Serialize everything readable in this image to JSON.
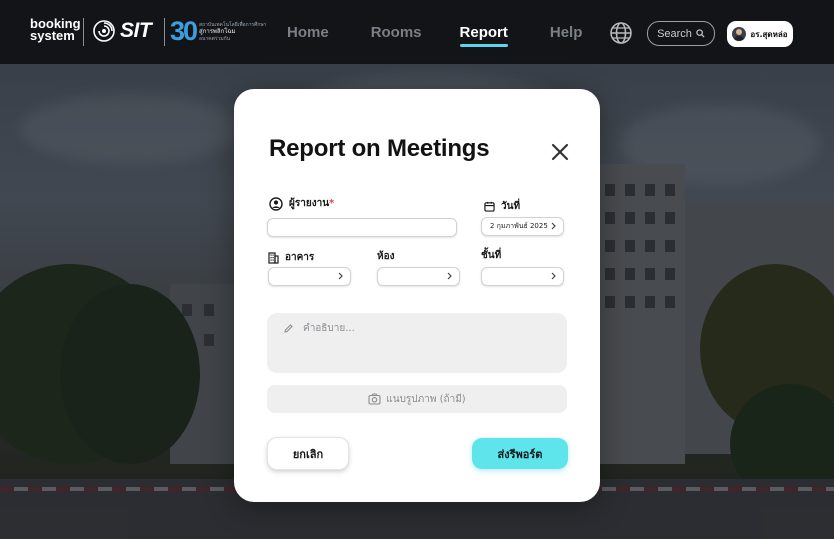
{
  "navbar": {
    "brand_line1": "booking",
    "brand_line2": "system",
    "sit_logo_text": "SIT",
    "anniversary_number": "30",
    "anniversary_line1": "สถาบันเทคโนโลยีเพื่อการศึกษา",
    "anniversary_line2": "สู่การพลิกโฉม",
    "anniversary_line3": "อนาคตร่วมกัน",
    "links": [
      {
        "label": "Home",
        "active": false
      },
      {
        "label": "Rooms",
        "active": false
      },
      {
        "label": "Report",
        "active": true
      },
      {
        "label": "Help",
        "active": false
      }
    ],
    "globe_icon": "globe-icon",
    "search_label": "Search",
    "user_name": "อร.สุดหล่อ"
  },
  "modal": {
    "title": "Report on Meetings",
    "close_icon": "close-icon",
    "reporter": {
      "label": "ผู้รายงาน",
      "required_mark": "*",
      "value": ""
    },
    "date": {
      "label": "วันที่",
      "value": "2 กุมภาพันธ์ 2025"
    },
    "building": {
      "label": "อาคาร",
      "value": ""
    },
    "room": {
      "label": "ห้อง",
      "value": ""
    },
    "floor": {
      "label": "ชั้นที่",
      "value": ""
    },
    "description": {
      "placeholder": "คำอธิบาย..."
    },
    "attach_label": "แนบรูปภาพ (ถ้ามี)",
    "cancel_label": "ยกเลิก",
    "submit_label": "ส่งรีพอร์ต"
  },
  "colors": {
    "navbar_bg": "#121417",
    "active_underline": "#5fd3ec",
    "submit_bg": "#5ee5ec",
    "required": "#e0463c",
    "anniversary_blue": "#3a9ee0"
  }
}
